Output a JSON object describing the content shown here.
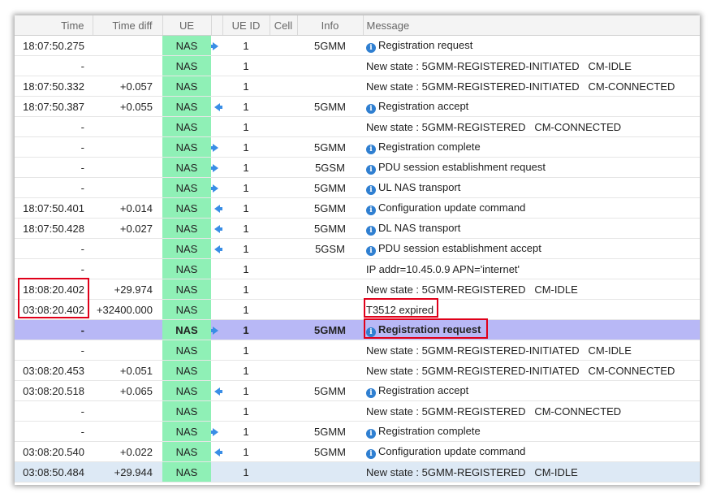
{
  "columns": [
    "Time",
    "Time diff",
    "UE",
    "",
    "UE ID",
    "Cell",
    "Info",
    "Message"
  ],
  "colors": {
    "ue_bg": "#8ff0b6",
    "highlight": "#b8b8f6",
    "last_row": "#dde9f5",
    "annotation": "#e0001a",
    "arrow": "#3a8ee6"
  },
  "rows": [
    {
      "time": "18:07:50.275",
      "diff": "",
      "ue": "NAS",
      "dir": "ul",
      "ueid": "1",
      "cell": "",
      "info": "5GMM",
      "icon": true,
      "message": "Registration request"
    },
    {
      "time": "-",
      "diff": "",
      "ue": "NAS",
      "dir": "",
      "ueid": "1",
      "cell": "",
      "info": "",
      "icon": false,
      "message": "New state : 5GMM-REGISTERED-INITIATED   CM-IDLE"
    },
    {
      "time": "18:07:50.332",
      "diff": "+0.057",
      "ue": "NAS",
      "dir": "",
      "ueid": "1",
      "cell": "",
      "info": "",
      "icon": false,
      "message": "New state : 5GMM-REGISTERED-INITIATED   CM-CONNECTED"
    },
    {
      "time": "18:07:50.387",
      "diff": "+0.055",
      "ue": "NAS",
      "dir": "dl",
      "ueid": "1",
      "cell": "",
      "info": "5GMM",
      "icon": true,
      "message": "Registration accept"
    },
    {
      "time": "-",
      "diff": "",
      "ue": "NAS",
      "dir": "",
      "ueid": "1",
      "cell": "",
      "info": "",
      "icon": false,
      "message": "New state : 5GMM-REGISTERED   CM-CONNECTED"
    },
    {
      "time": "-",
      "diff": "",
      "ue": "NAS",
      "dir": "ul",
      "ueid": "1",
      "cell": "",
      "info": "5GMM",
      "icon": true,
      "message": "Registration complete"
    },
    {
      "time": "-",
      "diff": "",
      "ue": "NAS",
      "dir": "ul",
      "ueid": "1",
      "cell": "",
      "info": "5GSM",
      "icon": true,
      "message": "PDU session establishment request"
    },
    {
      "time": "-",
      "diff": "",
      "ue": "NAS",
      "dir": "ul",
      "ueid": "1",
      "cell": "",
      "info": "5GMM",
      "icon": true,
      "message": "UL NAS transport"
    },
    {
      "time": "18:07:50.401",
      "diff": "+0.014",
      "ue": "NAS",
      "dir": "dl",
      "ueid": "1",
      "cell": "",
      "info": "5GMM",
      "icon": true,
      "message": "Configuration update command"
    },
    {
      "time": "18:07:50.428",
      "diff": "+0.027",
      "ue": "NAS",
      "dir": "dl",
      "ueid": "1",
      "cell": "",
      "info": "5GMM",
      "icon": true,
      "message": "DL NAS transport"
    },
    {
      "time": "-",
      "diff": "",
      "ue": "NAS",
      "dir": "dl",
      "ueid": "1",
      "cell": "",
      "info": "5GSM",
      "icon": true,
      "message": "PDU session establishment accept"
    },
    {
      "time": "-",
      "diff": "",
      "ue": "NAS",
      "dir": "",
      "ueid": "1",
      "cell": "",
      "info": "",
      "icon": false,
      "message": "IP addr=10.45.0.9 APN='internet'"
    },
    {
      "time": "18:08:20.402",
      "diff": "+29.974",
      "ue": "NAS",
      "dir": "",
      "ueid": "1",
      "cell": "",
      "info": "",
      "icon": false,
      "message": "New state : 5GMM-REGISTERED   CM-IDLE"
    },
    {
      "time": "03:08:20.402",
      "diff": "+32400.000",
      "ue": "NAS",
      "dir": "",
      "ueid": "1",
      "cell": "",
      "info": "",
      "icon": false,
      "message": "T3512 expired"
    },
    {
      "time": "-",
      "diff": "",
      "ue": "NAS",
      "dir": "ul",
      "ueid": "1",
      "cell": "",
      "info": "5GMM",
      "icon": true,
      "message": "Registration request",
      "highlight": true
    },
    {
      "time": "-",
      "diff": "",
      "ue": "NAS",
      "dir": "",
      "ueid": "1",
      "cell": "",
      "info": "",
      "icon": false,
      "message": "New state : 5GMM-REGISTERED-INITIATED   CM-IDLE"
    },
    {
      "time": "03:08:20.453",
      "diff": "+0.051",
      "ue": "NAS",
      "dir": "",
      "ueid": "1",
      "cell": "",
      "info": "",
      "icon": false,
      "message": "New state : 5GMM-REGISTERED-INITIATED   CM-CONNECTED"
    },
    {
      "time": "03:08:20.518",
      "diff": "+0.065",
      "ue": "NAS",
      "dir": "dl",
      "ueid": "1",
      "cell": "",
      "info": "5GMM",
      "icon": true,
      "message": "Registration accept"
    },
    {
      "time": "-",
      "diff": "",
      "ue": "NAS",
      "dir": "",
      "ueid": "1",
      "cell": "",
      "info": "",
      "icon": false,
      "message": "New state : 5GMM-REGISTERED   CM-CONNECTED"
    },
    {
      "time": "-",
      "diff": "",
      "ue": "NAS",
      "dir": "ul",
      "ueid": "1",
      "cell": "",
      "info": "5GMM",
      "icon": true,
      "message": "Registration complete"
    },
    {
      "time": "03:08:20.540",
      "diff": "+0.022",
      "ue": "NAS",
      "dir": "dl",
      "ueid": "1",
      "cell": "",
      "info": "5GMM",
      "icon": true,
      "message": "Configuration update command"
    },
    {
      "time": "03:08:50.484",
      "diff": "+29.944",
      "ue": "NAS",
      "dir": "",
      "ueid": "1",
      "cell": "",
      "info": "",
      "icon": false,
      "message": "New state : 5GMM-REGISTERED   CM-IDLE",
      "last": true
    }
  ]
}
